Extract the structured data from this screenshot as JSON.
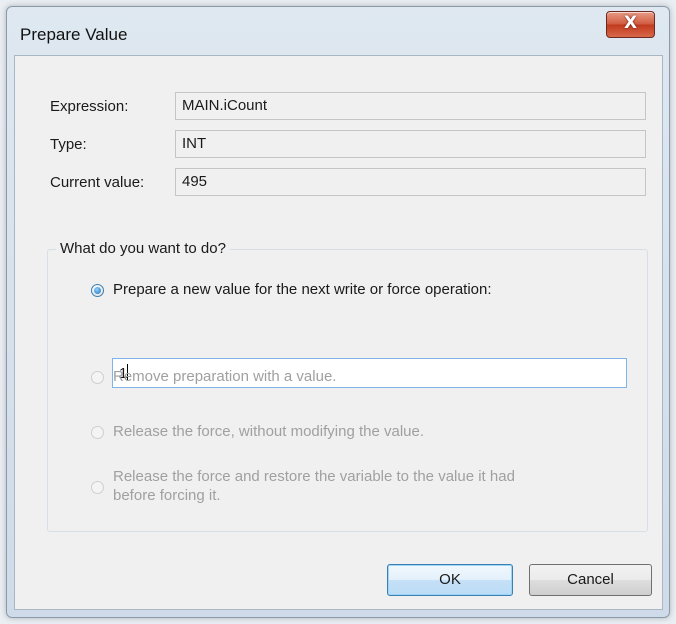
{
  "window": {
    "title": "Prepare Value",
    "close_glyph": "X"
  },
  "fields": {
    "expression_label": "Expression:",
    "expression_value": "MAIN.iCount",
    "type_label": "Type:",
    "type_value": "INT",
    "current_label": "Current value:",
    "current_value": "495"
  },
  "group": {
    "legend": "What do you want to do?",
    "options": [
      {
        "label": "Prepare a new value for the next write or force operation:",
        "checked": true,
        "enabled": true
      },
      {
        "label": "Remove preparation with a value.",
        "checked": false,
        "enabled": false
      },
      {
        "label": "Release the force, without modifying the value.",
        "checked": false,
        "enabled": false
      },
      {
        "label_line1": "Release the force and restore the variable to the value it had",
        "label_line2": "before forcing it.",
        "checked": false,
        "enabled": false
      }
    ],
    "new_value": "1"
  },
  "buttons": {
    "ok": "OK",
    "cancel": "Cancel"
  },
  "colors": {
    "close_button": "#c0391e",
    "focus_border": "#3c7fb1",
    "disabled_text": "#a0a0a0"
  }
}
